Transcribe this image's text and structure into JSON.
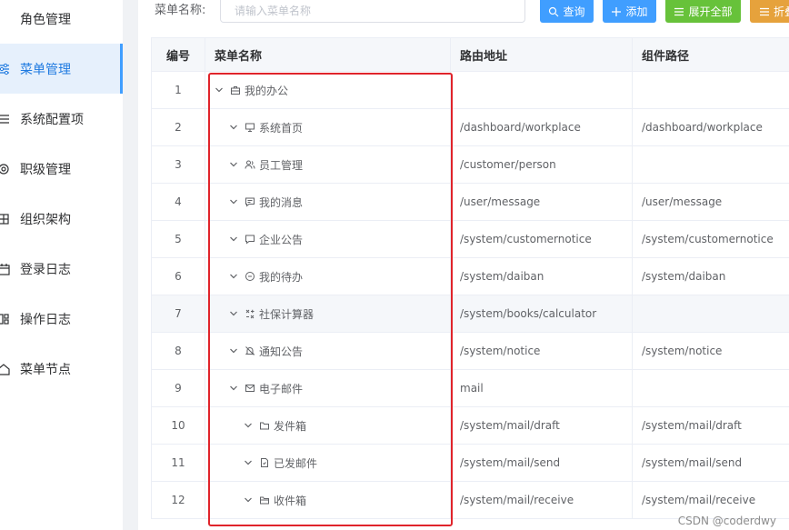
{
  "sidebar": {
    "items": [
      {
        "label": "角色管理",
        "icon": "role-icon",
        "active": false
      },
      {
        "label": "菜单管理",
        "icon": "menu-sliders-icon",
        "active": true
      },
      {
        "label": "系统配置项",
        "icon": "list-icon",
        "active": false
      },
      {
        "label": "职级管理",
        "icon": "gear-icon",
        "active": false
      },
      {
        "label": "组织架构",
        "icon": "grid-icon",
        "active": false
      },
      {
        "label": "登录日志",
        "icon": "calendar-icon",
        "active": false
      },
      {
        "label": "操作日志",
        "icon": "dashboard-icon",
        "active": false
      },
      {
        "label": "菜单节点",
        "icon": "home-icon",
        "active": false
      }
    ]
  },
  "search": {
    "label": "菜单名称:",
    "placeholder": "请输入菜单名称",
    "value": ""
  },
  "toolbar": {
    "query_label": "查询",
    "add_label": "添加",
    "expand_label": "展开全部",
    "fold_label": "折叠"
  },
  "colors": {
    "primary": "#409eff",
    "success": "#67c23a",
    "warning": "#e6a23c",
    "highlight_border": "#e0242b"
  },
  "table": {
    "headers": {
      "num": "编号",
      "name": "菜单名称",
      "route": "路由地址",
      "component": "组件路径"
    },
    "rows": [
      {
        "num": "1",
        "name": "我的办公",
        "icon": "briefcase-icon",
        "level": 0,
        "route": "",
        "component": ""
      },
      {
        "num": "2",
        "name": "系统首页",
        "icon": "monitor-icon",
        "level": 1,
        "route": "/dashboard/workplace",
        "component": "/dashboard/workplace"
      },
      {
        "num": "3",
        "name": "员工管理",
        "icon": "users-icon",
        "level": 1,
        "route": "/customer/person",
        "component": ""
      },
      {
        "num": "4",
        "name": "我的消息",
        "icon": "message-icon",
        "level": 1,
        "route": "/user/message",
        "component": "/user/message"
      },
      {
        "num": "5",
        "name": "企业公告",
        "icon": "chat-icon",
        "level": 1,
        "route": "/system/customernotice",
        "component": "/system/customernotice"
      },
      {
        "num": "6",
        "name": "我的待办",
        "icon": "clock-icon",
        "level": 1,
        "route": "/system/daiban",
        "component": "/system/daiban"
      },
      {
        "num": "7",
        "name": "社保计算器",
        "icon": "calculator-icon",
        "level": 1,
        "route": "/system/books/calculator",
        "component": ""
      },
      {
        "num": "8",
        "name": "通知公告",
        "icon": "bell-icon",
        "level": 1,
        "route": "/system/notice",
        "component": "/system/notice"
      },
      {
        "num": "9",
        "name": "电子邮件",
        "icon": "mail-icon",
        "level": 1,
        "route": "mail",
        "component": ""
      },
      {
        "num": "10",
        "name": "发件箱",
        "icon": "folder-icon",
        "level": 2,
        "route": "/system/mail/draft",
        "component": "/system/mail/draft"
      },
      {
        "num": "11",
        "name": "已发邮件",
        "icon": "document-icon",
        "level": 2,
        "route": "/system/mail/send",
        "component": "/system/mail/send"
      },
      {
        "num": "12",
        "name": "收件箱",
        "icon": "folder-open-icon",
        "level": 2,
        "route": "/system/mail/receive",
        "component": "/system/mail/receive"
      }
    ]
  },
  "watermark": "CSDN @coderdwy"
}
